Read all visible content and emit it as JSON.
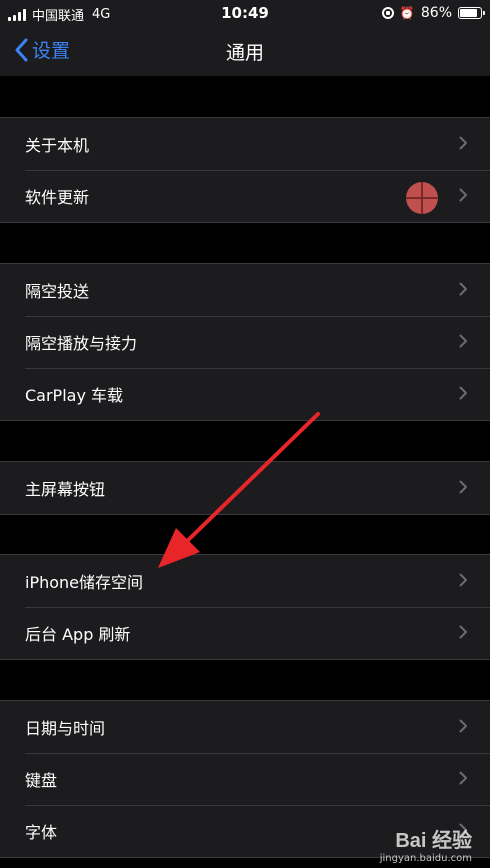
{
  "status_bar": {
    "carrier": "中国联通",
    "network": "4G",
    "time": "10:49",
    "battery": "86%",
    "battery_level": 0.86
  },
  "nav": {
    "back_label": "设置",
    "title": "通用"
  },
  "groups": [
    {
      "rows": [
        {
          "label": "关于本机"
        },
        {
          "label": "软件更新",
          "badge": true
        }
      ]
    },
    {
      "rows": [
        {
          "label": "隔空投送"
        },
        {
          "label": "隔空播放与接力"
        },
        {
          "label": "CarPlay 车载"
        }
      ]
    },
    {
      "rows": [
        {
          "label": "主屏幕按钮"
        }
      ]
    },
    {
      "rows": [
        {
          "label": "iPhone储存空间"
        },
        {
          "label": "后台 App 刷新"
        }
      ]
    },
    {
      "rows": [
        {
          "label": "日期与时间"
        },
        {
          "label": "键盘"
        },
        {
          "label": "字体"
        }
      ]
    }
  ],
  "colors": {
    "accent": "#3b82f6",
    "arrow": "#e8262a"
  },
  "watermark": {
    "logo": "Bai 经验",
    "url": "jingyan.baidu.com"
  }
}
